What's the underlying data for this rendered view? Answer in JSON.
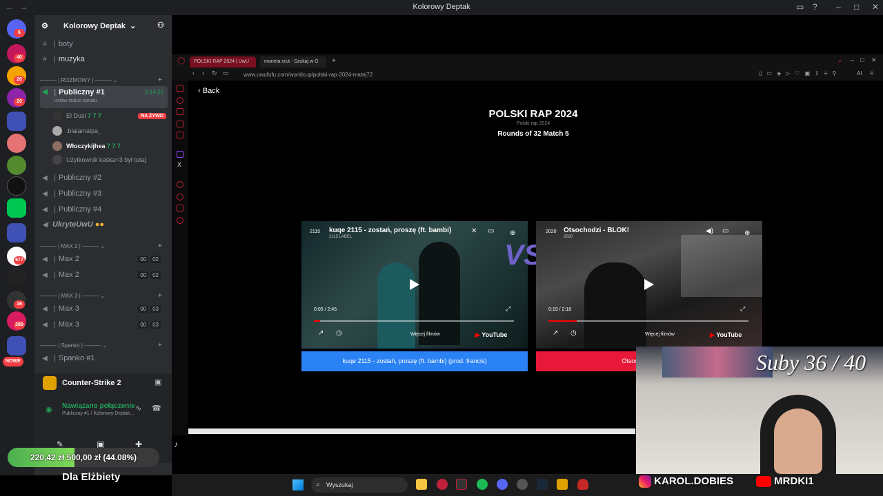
{
  "titlebar": {
    "title": "Kolorowy Deptak",
    "back": "←",
    "forward": "→"
  },
  "servers": [
    {
      "badge": "6"
    },
    {
      "badge": "40"
    },
    {
      "badge": "20"
    },
    {
      "badge": "20"
    },
    {
      "badge": ""
    },
    {
      "badge": ""
    },
    {
      "badge": ""
    },
    {
      "badge": ""
    },
    {
      "badge": ""
    },
    {
      "badge": "677"
    },
    {
      "badge": ""
    },
    {
      "badge": "16"
    },
    {
      "badge": "289"
    },
    {
      "badge": "NOWE"
    }
  ],
  "guild": {
    "name": "Kolorowy Deptak"
  },
  "channels": {
    "text": [
      {
        "name": "boty"
      },
      {
        "name": "muzyka"
      }
    ],
    "cat_rozmowy": "ROZMOWY",
    "publiczny1": {
      "name": "Publiczny #1",
      "time": "5:14:25",
      "status": "Ustaw status kanału"
    },
    "users": [
      {
        "name": "El Dusi",
        "extra": "7 7 7",
        "live": "NA ŻYWO"
      },
      {
        "name": ".bialamalpa_",
        "extra": "",
        "live": ""
      },
      {
        "name": "Włoczykijhea",
        "extra": "7 7 7",
        "live": ""
      },
      {
        "name": "Użytkownik",
        "extra": "kaśka<3 był tutaj",
        "live": ""
      }
    ],
    "voice": [
      {
        "name": "Publiczny #2"
      },
      {
        "name": "Publiczny #3"
      },
      {
        "name": "Publiczny #4"
      },
      {
        "name": "UkryteUwU"
      }
    ],
    "cat_max2": "MAX 2",
    "max2": [
      {
        "name": "Max 2",
        "a": "00",
        "b": "02"
      },
      {
        "name": "Max 2",
        "a": "00",
        "b": "02"
      }
    ],
    "cat_max3": "MAX 3",
    "max3": [
      {
        "name": "Max 3",
        "a": "00",
        "b": "03"
      },
      {
        "name": "Max 3",
        "a": "00",
        "b": "03"
      }
    ],
    "cat_spanko": "Spanko",
    "spanko": [
      {
        "name": "Spanko #1"
      }
    ]
  },
  "voice_panel": {
    "game": "Counter-Strike 2",
    "status": "Nawiązano połączenie",
    "detail": "Publiczny #1 / Kolorowy Deptak..."
  },
  "browser": {
    "tabs": [
      {
        "label": "POLSKI RAP 2024 | UwU"
      },
      {
        "label": "moneta rzut - Szukaj w G"
      }
    ],
    "url": "www.uwufufu.com/worldcup/polski-rap-2024-matej72",
    "ai": "AI"
  },
  "page": {
    "back": "Back",
    "title": "POLSKI RAP 2024",
    "subtitle": "Polski rap 2024",
    "round": "Rounds of 32 Match 5",
    "vs": "VS",
    "left": {
      "title": "kuqe 2115 - zostań, proszę (ft. bambi)",
      "channel": "2115 LABEL",
      "time": "0:05 / 2:45",
      "progress": 0.03,
      "more": "Więcej filmów",
      "yt": "YouTube",
      "button": "kuqe 2115 - zostań, proszę (ft. bambi) (prod. francis)",
      "color": "#2b82f5"
    },
    "right": {
      "title": "Otsochodzi - BLOK!",
      "channel": "2020",
      "time": "0:19 / 2:18",
      "progress": 0.14,
      "more": "Więcej filmów",
      "yt": "YouTube",
      "button": "Otsochodzi - BLOK!",
      "color": "#e8183a"
    }
  },
  "taskbar": {
    "search": "Wyszukaj"
  },
  "overlay": {
    "donation_text": "220,42 zł  500,00 zł (44.08%)",
    "donation_progress": 0.4408,
    "donation_label": "Dla Elżbiety",
    "subs": "Suby 36 / 40",
    "instagram": "KAROL.DOBIES",
    "youtube": "MRDKI1"
  }
}
